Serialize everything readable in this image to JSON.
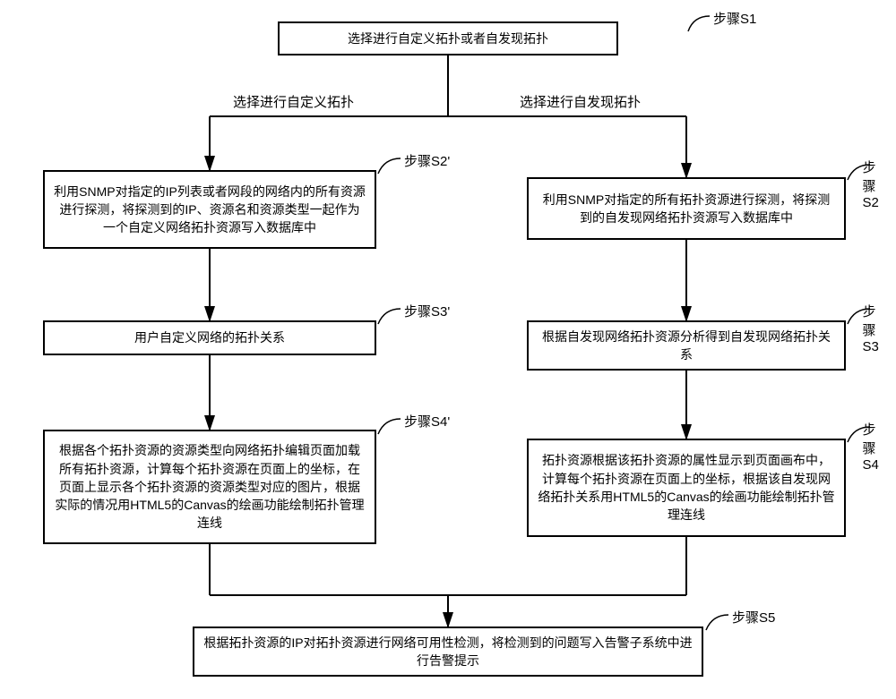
{
  "boxes": {
    "s1": "选择进行自定义拓扑或者自发现拓扑",
    "s2p": "利用SNMP对指定的IP列表或者网段的网络内的所有资源进行探测，将探测到的IP、资源名和资源类型一起作为一个自定义网络拓扑资源写入数据库中",
    "s2": "利用SNMP对指定的所有拓扑资源进行探测，将探测到的自发现网络拓扑资源写入数据库中",
    "s3p": "用户自定义网络的拓扑关系",
    "s3": "根据自发现网络拓扑资源分析得到自发现网络拓扑关系",
    "s4p": "根据各个拓扑资源的资源类型向网络拓扑编辑页面加载所有拓扑资源，计算每个拓扑资源在页面上的坐标，在页面上显示各个拓扑资源的资源类型对应的图片，根据实际的情况用HTML5的Canvas的绘画功能绘制拓扑管理连线",
    "s4": "拓扑资源根据该拓扑资源的属性显示到页面画布中，计算每个拓扑资源在页面上的坐标，根据该自发现网络拓扑关系用HTML5的Canvas的绘画功能绘制拓扑管理连线",
    "s5": "根据拓扑资源的IP对拓扑资源进行网络可用性检测，将检测到的问题写入告警子系统中进行告警提示"
  },
  "branchLabels": {
    "left": "选择进行自定义拓扑",
    "right": "选择进行自发现拓扑"
  },
  "stepLabels": {
    "s1": "步骤S1",
    "s2p": "步骤S2'",
    "s2": "步骤S2",
    "s3p": "步骤S3'",
    "s3": "步骤S3",
    "s4p": "步骤S4'",
    "s4": "步骤S4",
    "s5": "步骤S5"
  }
}
